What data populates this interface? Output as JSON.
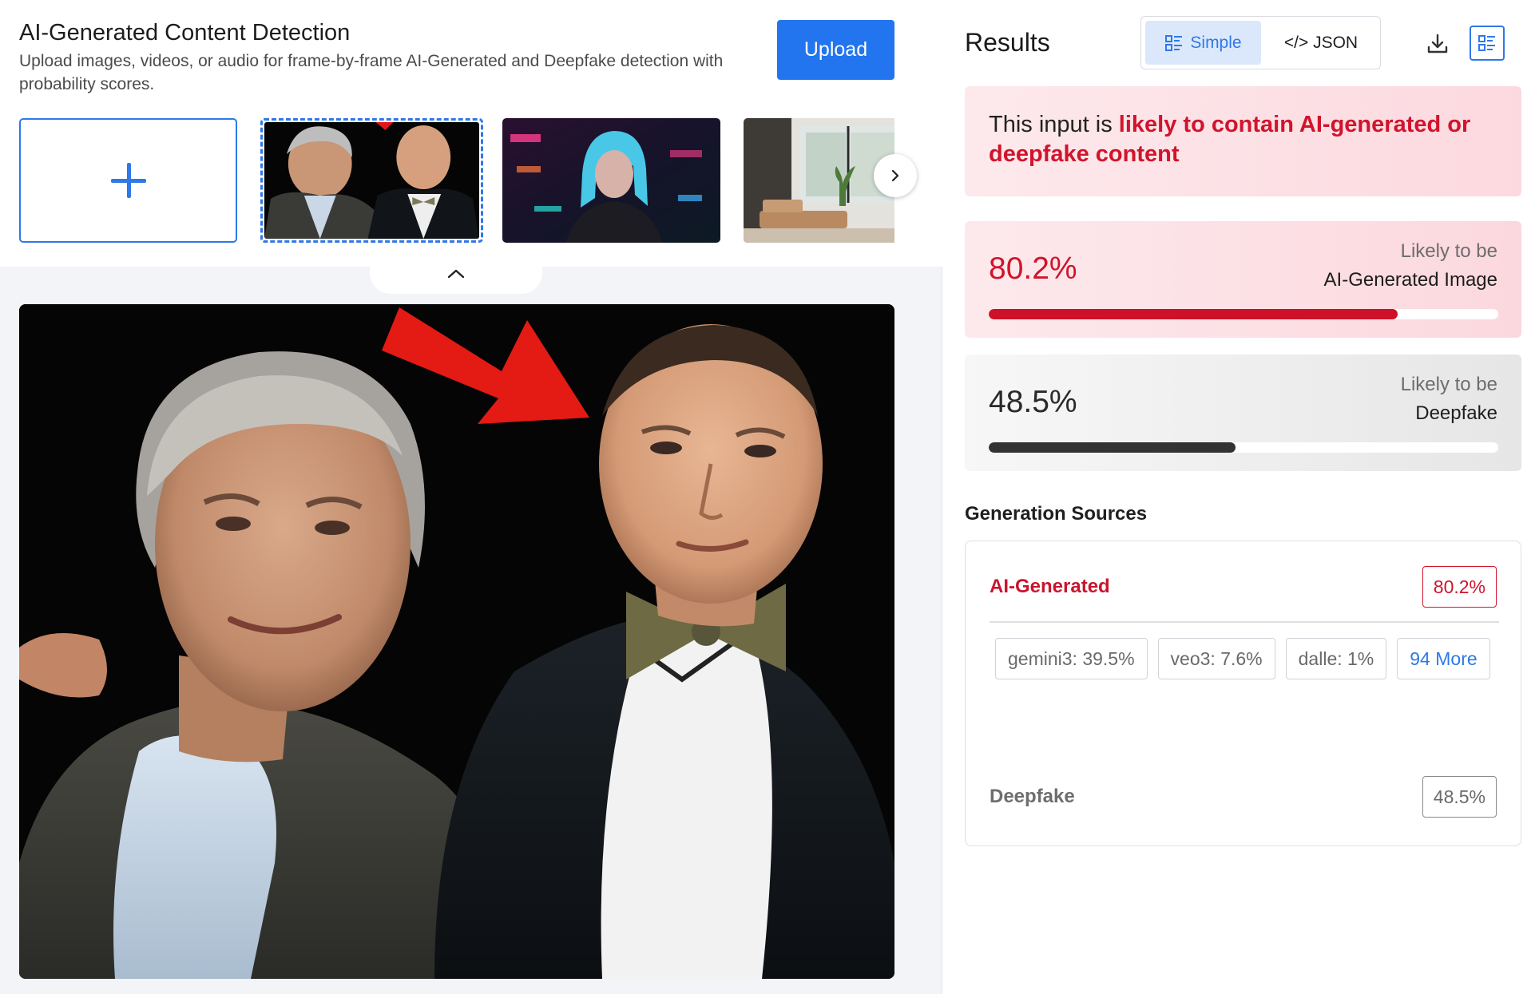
{
  "header": {
    "title": "AI-Generated Content Detection",
    "subtitle": "Upload images, videos, or audio for frame-by-frame AI-Generated and Deepfake detection with probability scores.",
    "upload_label": "Upload"
  },
  "gallery": {
    "add_icon": "plus-icon",
    "items": [
      {
        "name": "two-men-photo",
        "selected": true
      },
      {
        "name": "cyberpunk-woman",
        "selected": false
      },
      {
        "name": "living-room",
        "selected": false
      }
    ],
    "next_icon": "chevron-right-icon",
    "collapse_icon": "chevron-up-icon"
  },
  "results": {
    "title": "Results",
    "view_simple": "Simple",
    "view_json": "</> JSON",
    "download_icon": "download-icon",
    "layout_icon": "list-view-icon",
    "verdict_prefix": "This input is ",
    "verdict_highlight": "likely to contain AI-generated or deepfake content",
    "scores": [
      {
        "percent": "80.2%",
        "value": 0.802,
        "kicker": "Likely to be",
        "label": "AI-Generated Image",
        "color": "#cc1128"
      },
      {
        "percent": "48.5%",
        "value": 0.485,
        "kicker": "Likely to be",
        "label": "Deepfake",
        "color": "#333333"
      }
    ],
    "generation_sources_title": "Generation Sources",
    "ai_generated": {
      "label": "AI-Generated",
      "percent": "80.2%",
      "sources": [
        "gemini3: 39.5%",
        "veo3: 7.6%",
        "dalle: 1%"
      ],
      "more_label": "94 More"
    },
    "deepfake": {
      "label": "Deepfake",
      "percent": "48.5%"
    }
  },
  "colors": {
    "accent": "#2275ee",
    "danger": "#d0142c",
    "neutral": "#333333"
  }
}
